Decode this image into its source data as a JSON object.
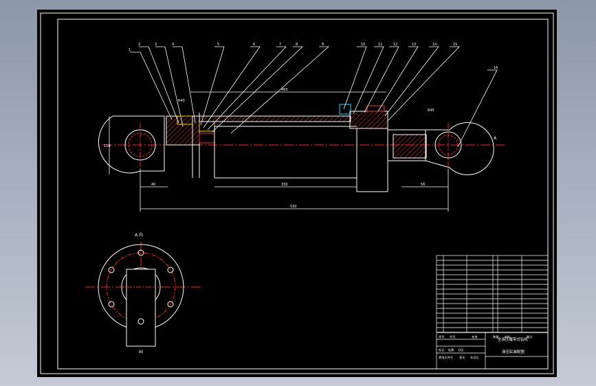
{
  "drawing": {
    "balloon_numbers": [
      "1",
      "2",
      "3",
      "4",
      "5",
      "6",
      "7",
      "8",
      "9",
      "10",
      "11",
      "12",
      "13",
      "14",
      "15",
      "16"
    ],
    "dimensions": {
      "bore_height": "110",
      "left_end_width": "40",
      "rod_length": "330",
      "right_end_width": "56",
      "overall_length": "530",
      "top_length": "460",
      "left_angle": "R40",
      "right_angle": "R45",
      "bottom_view_width": "80"
    },
    "section_label": "A",
    "view_label": "A 向",
    "title_block": {
      "drawing_name": "液压缸装配图",
      "project_name": "全液压履带式钻机",
      "sign_row": [
        "标记",
        "处数",
        "分区",
        "更改文件号",
        "签名",
        "年月日"
      ],
      "header_row": [
        "序号",
        "代号",
        "名称",
        "数量",
        "材料",
        "备注"
      ]
    }
  },
  "colors": {
    "sheet": "#000000",
    "line": "#ffffff",
    "center": "#ff2020",
    "hatch": "#ff3030",
    "cyan": "#00e5ff",
    "green": "#20c040",
    "yellow": "#ffd400"
  }
}
